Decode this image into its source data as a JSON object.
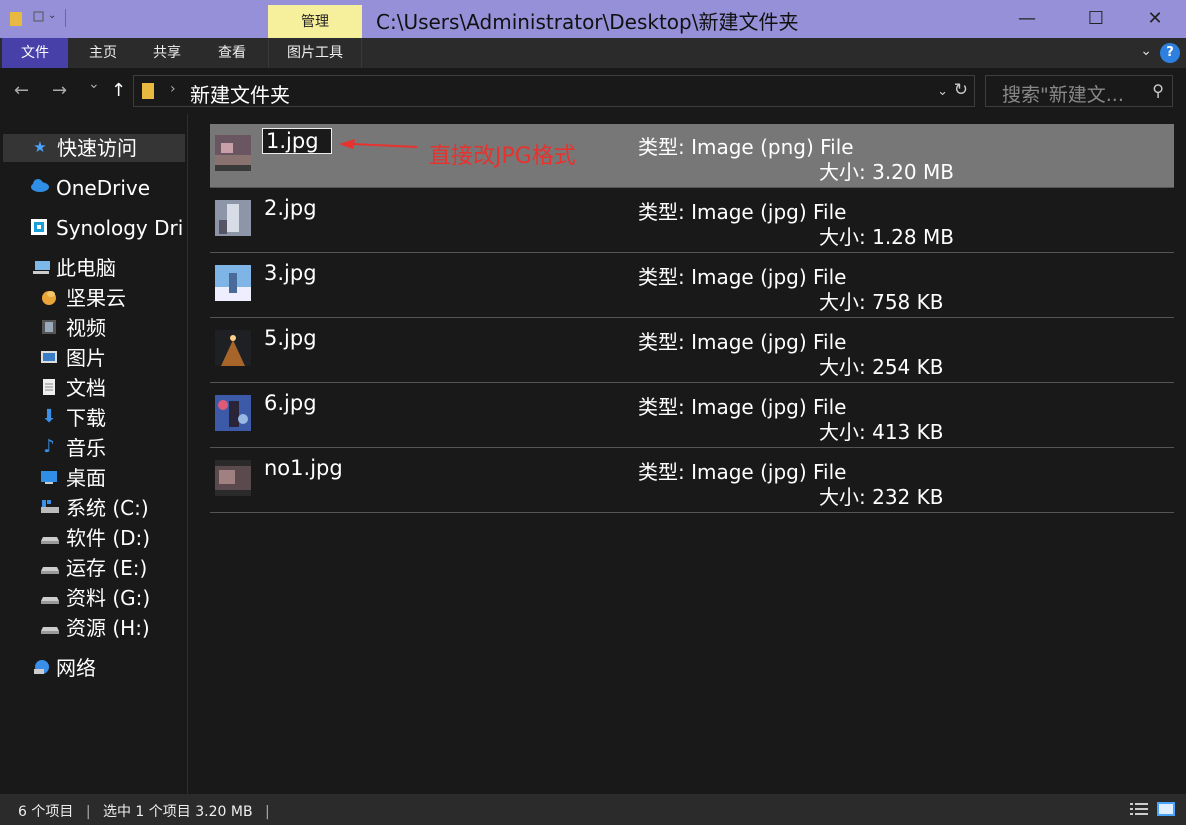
{
  "window": {
    "title": "C:\\Users\\Administrator\\Desktop\\新建文件夹",
    "context_tab": "管理",
    "minimize": "—",
    "maximize": "☐",
    "close": "✕"
  },
  "ribbon": {
    "tabs": [
      "文件",
      "主页",
      "共享",
      "查看",
      "图片工具"
    ],
    "help": "?"
  },
  "address": {
    "path": "新建文件夹",
    "search_placeholder": "搜索\"新建文...",
    "back": "←",
    "forward": "→",
    "recent": "⌄",
    "up": "↑"
  },
  "sidebar": {
    "items": [
      {
        "label": "快速访问",
        "icon": "star-icon"
      },
      {
        "label": "OneDrive",
        "icon": "cloud-icon"
      },
      {
        "label": "Synology Dri",
        "icon": "synology-drive-icon"
      },
      {
        "label": "此电脑",
        "icon": "computer-icon"
      },
      {
        "label": "坚果云",
        "icon": "nut-icon"
      },
      {
        "label": "视频",
        "icon": "video-icon"
      },
      {
        "label": "图片",
        "icon": "picture-icon"
      },
      {
        "label": "文档",
        "icon": "document-icon"
      },
      {
        "label": "下载",
        "icon": "download-icon"
      },
      {
        "label": "音乐",
        "icon": "music-icon"
      },
      {
        "label": "桌面",
        "icon": "desktop-icon"
      },
      {
        "label": "系统 (C:)",
        "icon": "system-drive-icon"
      },
      {
        "label": "软件 (D:)",
        "icon": "drive-icon"
      },
      {
        "label": "运存 (E:)",
        "icon": "drive-icon"
      },
      {
        "label": "资料 (G:)",
        "icon": "drive-icon"
      },
      {
        "label": "资源 (H:)",
        "icon": "drive-icon"
      },
      {
        "label": "网络",
        "icon": "network-icon"
      }
    ]
  },
  "files": [
    {
      "name": "1.jpg",
      "type": "类型: Image (png) File",
      "size": "大小: 3.20  MB",
      "selected": true
    },
    {
      "name": "2.jpg",
      "type": "类型: Image (jpg) File",
      "size": "大小: 1.28  MB"
    },
    {
      "name": "3.jpg",
      "type": "类型: Image (jpg) File",
      "size": "大小: 758  KB"
    },
    {
      "name": "5.jpg",
      "type": "类型: Image (jpg) File",
      "size": "大小: 254  KB"
    },
    {
      "name": "6.jpg",
      "type": "类型: Image (jpg) File",
      "size": "大小: 413  KB"
    },
    {
      "name": "no1.jpg",
      "type": "类型: Image (jpg) File",
      "size": "大小: 232  KB"
    }
  ],
  "annotation": "直接改JPG格式",
  "status": {
    "count": "6 个项目",
    "selected": "选中 1 个项目  3.20 MB"
  },
  "colors": {
    "titlebar": "#9690d8",
    "file_tab": "#4640a8",
    "context_tab": "#f6ef9c",
    "annotation": "#e8322e"
  }
}
